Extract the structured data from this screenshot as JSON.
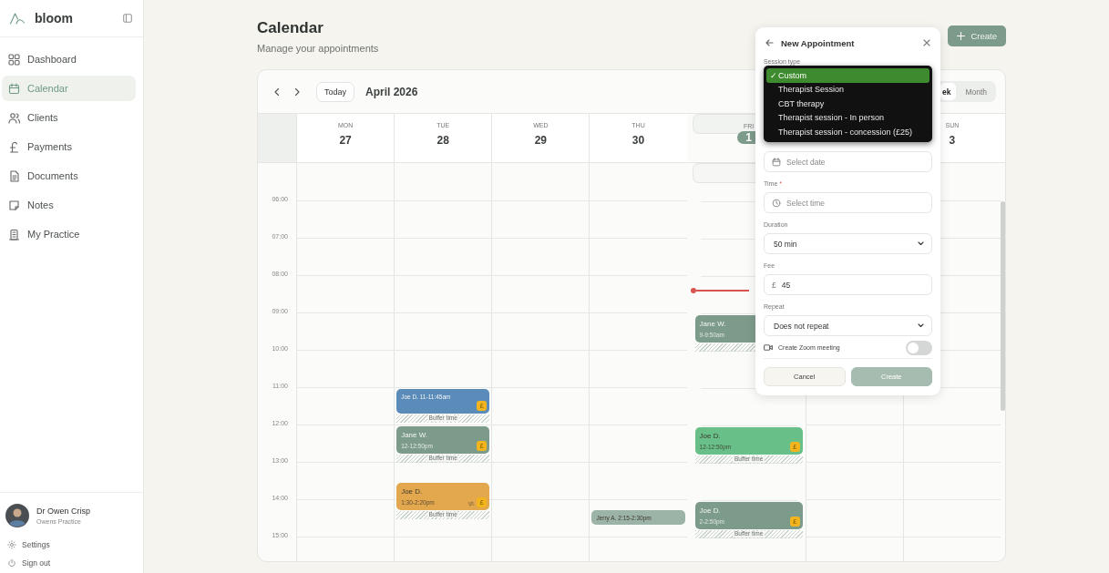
{
  "sidebar": {
    "brand": "bloom",
    "items": [
      {
        "label": "Dashboard",
        "selected": false
      },
      {
        "label": "Calendar",
        "selected": true
      },
      {
        "label": "Clients",
        "selected": false
      },
      {
        "label": "Payments",
        "selected": false
      },
      {
        "label": "Documents",
        "selected": false
      },
      {
        "label": "Notes",
        "selected": false
      },
      {
        "label": "My Practice",
        "selected": false
      }
    ],
    "user": {
      "name": "Dr Owen Crisp",
      "practice": "Owens Practice"
    },
    "footer": [
      {
        "label": "Settings"
      },
      {
        "label": "Sign out"
      }
    ]
  },
  "page": {
    "title": "Calendar",
    "subtitle": "Manage your appointments",
    "create_button": "Create"
  },
  "calendar": {
    "today_button": "Today",
    "period": "April 2026",
    "views": [
      {
        "label": "ek",
        "selected": true
      },
      {
        "label": "Month",
        "selected": false
      }
    ],
    "hours": [
      "06:00",
      "07:00",
      "08:00",
      "09:00",
      "10:00",
      "11:00",
      "12:00",
      "13:00",
      "14:00",
      "15:00"
    ],
    "days": [
      {
        "name": "MON",
        "date": "27",
        "today": false
      },
      {
        "name": "TUE",
        "date": "28",
        "today": false,
        "events": [
          {
            "kind": "inline",
            "title": "Joe D. 11-11:45am",
            "color": "#5b8cb9",
            "badge": "£",
            "buffer_label": "Buffer time"
          },
          {
            "kind": "stacked",
            "title": "Jane W.",
            "time": "12-12:50pm",
            "color": "#7d9b8b",
            "badge": "£",
            "buffer_label": "Buffer time"
          },
          {
            "kind": "stacked",
            "title": "Joe D.",
            "time": "1:30-2:20pm",
            "color": "#e3a74e",
            "badge": "£",
            "recurring": true,
            "buffer_label": "Buffer time"
          }
        ]
      },
      {
        "name": "WED",
        "date": "29",
        "today": false
      },
      {
        "name": "THU",
        "date": "30",
        "today": false,
        "events": [
          {
            "kind": "inline",
            "title": "Jerry A. 2:15-2:30pm",
            "color": "#9cb4a7"
          }
        ]
      },
      {
        "name": "FRI",
        "date": "1",
        "today": true,
        "events": [
          {
            "kind": "stacked",
            "title": "Jane W.",
            "time": "9-9:50am",
            "color": "#7d9b8b",
            "buffer": true
          },
          {
            "kind": "stacked",
            "title": "Joe D.",
            "time": "12-12:50pm",
            "color": "#68bf87",
            "badge": "£",
            "buffer_label": "Buffer time"
          },
          {
            "kind": "stacked",
            "title": "Joe D.",
            "time": "2-2:50pm",
            "color": "#7d9b8b",
            "badge": "£",
            "buffer_label": "Buffer time"
          }
        ]
      },
      {
        "name": "SUN",
        "date": "3",
        "today": false,
        "covered_before": true
      }
    ]
  },
  "modal": {
    "title": "New Appointment",
    "session_type_label": "Session type",
    "check_mark": "✓",
    "session_options": [
      {
        "label": "Custom",
        "selected": true
      },
      {
        "label": "Therapist Session",
        "selected": false
      },
      {
        "label": "CBT therapy",
        "selected": false
      },
      {
        "label": "Therapist session - In person",
        "selected": false
      },
      {
        "label": "Therapist session - concession (£25)",
        "selected": false
      }
    ],
    "fields": [
      {
        "kind": "date",
        "placeholder": "Select date"
      },
      {
        "kind": "time",
        "label": "Time",
        "required_mark": "*",
        "placeholder": "Select time"
      },
      {
        "kind": "select",
        "label": "Duration",
        "value": "50 min"
      },
      {
        "kind": "money",
        "label": "Fee",
        "prefix": "£",
        "value": "45"
      },
      {
        "kind": "select",
        "label": "Repeat",
        "value": "Does not repeat"
      }
    ],
    "zoom": {
      "label": "Create Zoom meeting",
      "on": false
    },
    "buttons": [
      {
        "label": "Cancel",
        "kind": "secondary"
      },
      {
        "label": "Create",
        "kind": "primary",
        "disabled": true
      }
    ]
  }
}
